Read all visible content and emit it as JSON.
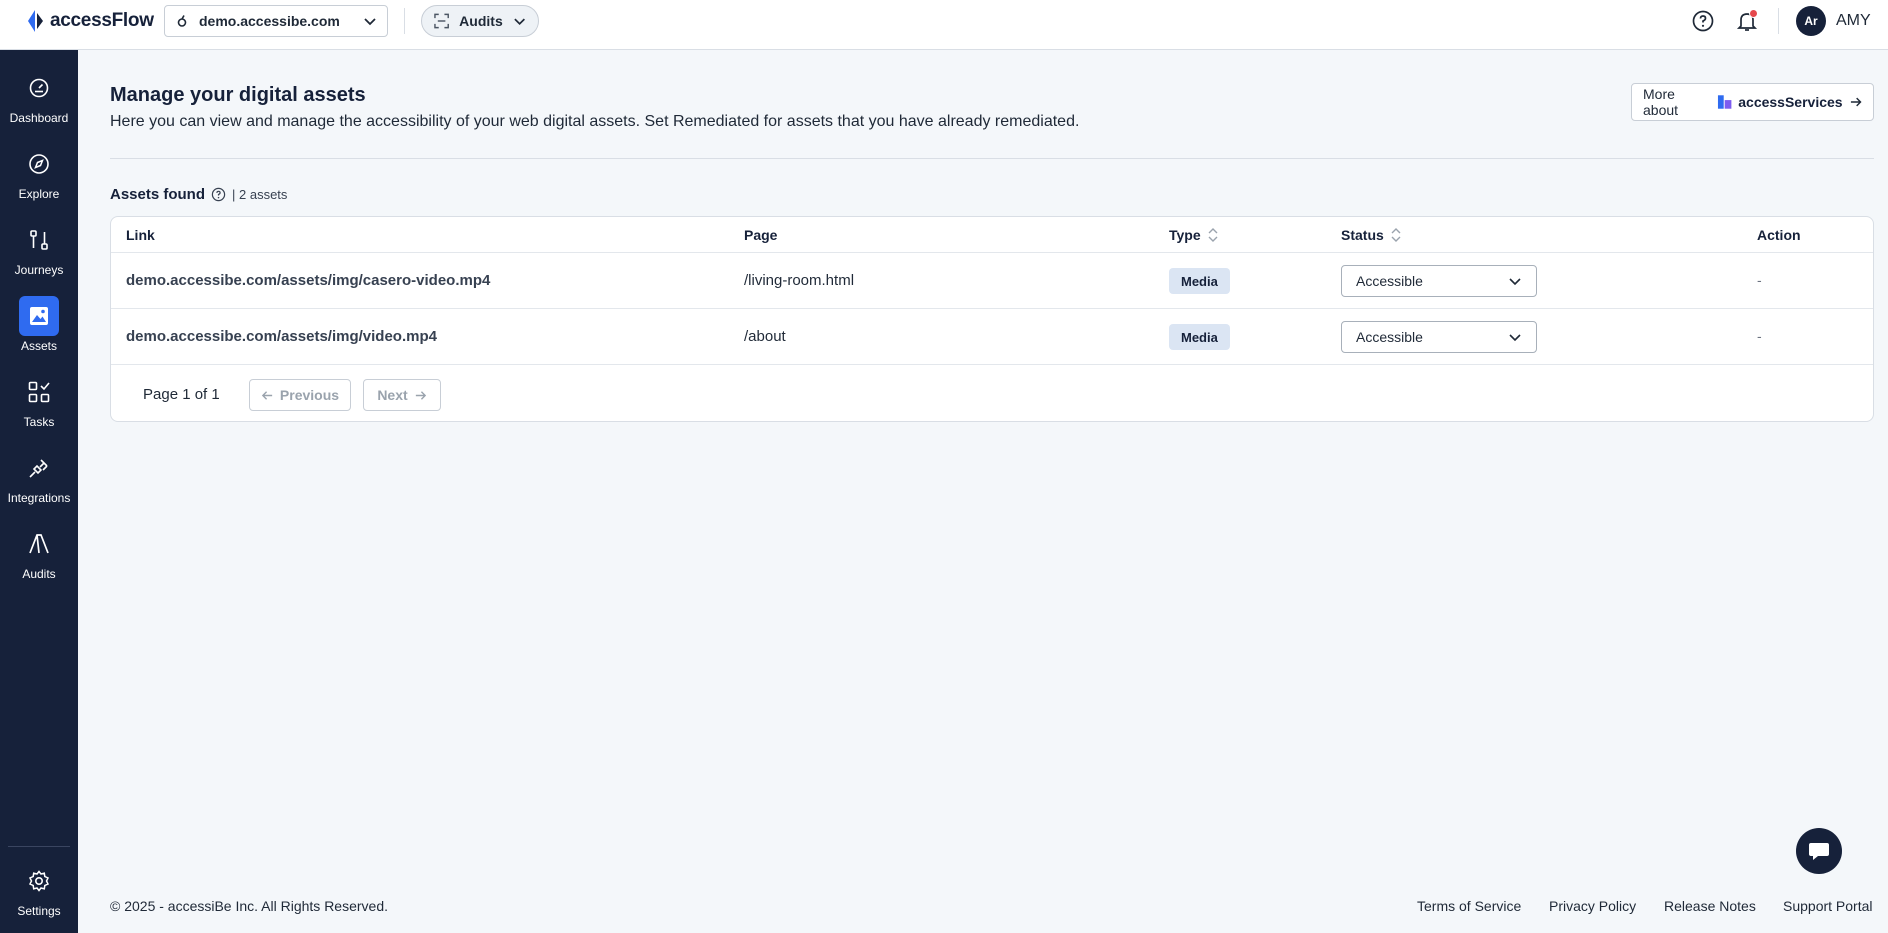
{
  "app": {
    "name": "accessFlow"
  },
  "header": {
    "site": "demo.accessibe.com",
    "mode": "Audits",
    "user_initials": "Ar",
    "user_name": "AMY"
  },
  "sidebar": {
    "items": [
      {
        "label": "Dashboard",
        "icon": "dashboard-icon"
      },
      {
        "label": "Explore",
        "icon": "compass-icon"
      },
      {
        "label": "Journeys",
        "icon": "journeys-icon"
      },
      {
        "label": "Assets",
        "icon": "image-icon",
        "active": true
      },
      {
        "label": "Tasks",
        "icon": "tasks-icon"
      },
      {
        "label": "Integrations",
        "icon": "plug-icon"
      },
      {
        "label": "Audits",
        "icon": "audits-icon"
      }
    ],
    "settings": "Settings"
  },
  "main": {
    "title": "Manage your digital assets",
    "description": "Here you can view and manage the accessibility of your web digital assets. Set Remediated for assets that you have already remediated.",
    "more_about": "More about",
    "services": "accessServices",
    "assets_found": "Assets found",
    "assets_count": "| 2 assets"
  },
  "table": {
    "columns": [
      "Link",
      "Page",
      "Type",
      "Status",
      "Action"
    ],
    "rows": [
      {
        "link": "demo.accessibe.com/assets/img/casero-video.mp4",
        "page": "/living-room.html",
        "type": "Media",
        "status": "Accessible",
        "action": "-"
      },
      {
        "link": "demo.accessibe.com/assets/img/video.mp4",
        "page": "/about",
        "type": "Media",
        "status": "Accessible",
        "action": "-"
      }
    ]
  },
  "pagination": {
    "text": "Page 1 of 1",
    "previous": "Previous",
    "next": "Next"
  },
  "footer": {
    "copyright": "© 2025 - accessiBe Inc. All Rights Reserved.",
    "links": [
      "Terms of Service",
      "Privacy Policy",
      "Release Notes",
      "Support Portal"
    ]
  },
  "colors": {
    "sidebar": "#16213a",
    "accent": "#2f6bf0",
    "badge": "#dbe5f3",
    "notification": "#e5484d"
  }
}
